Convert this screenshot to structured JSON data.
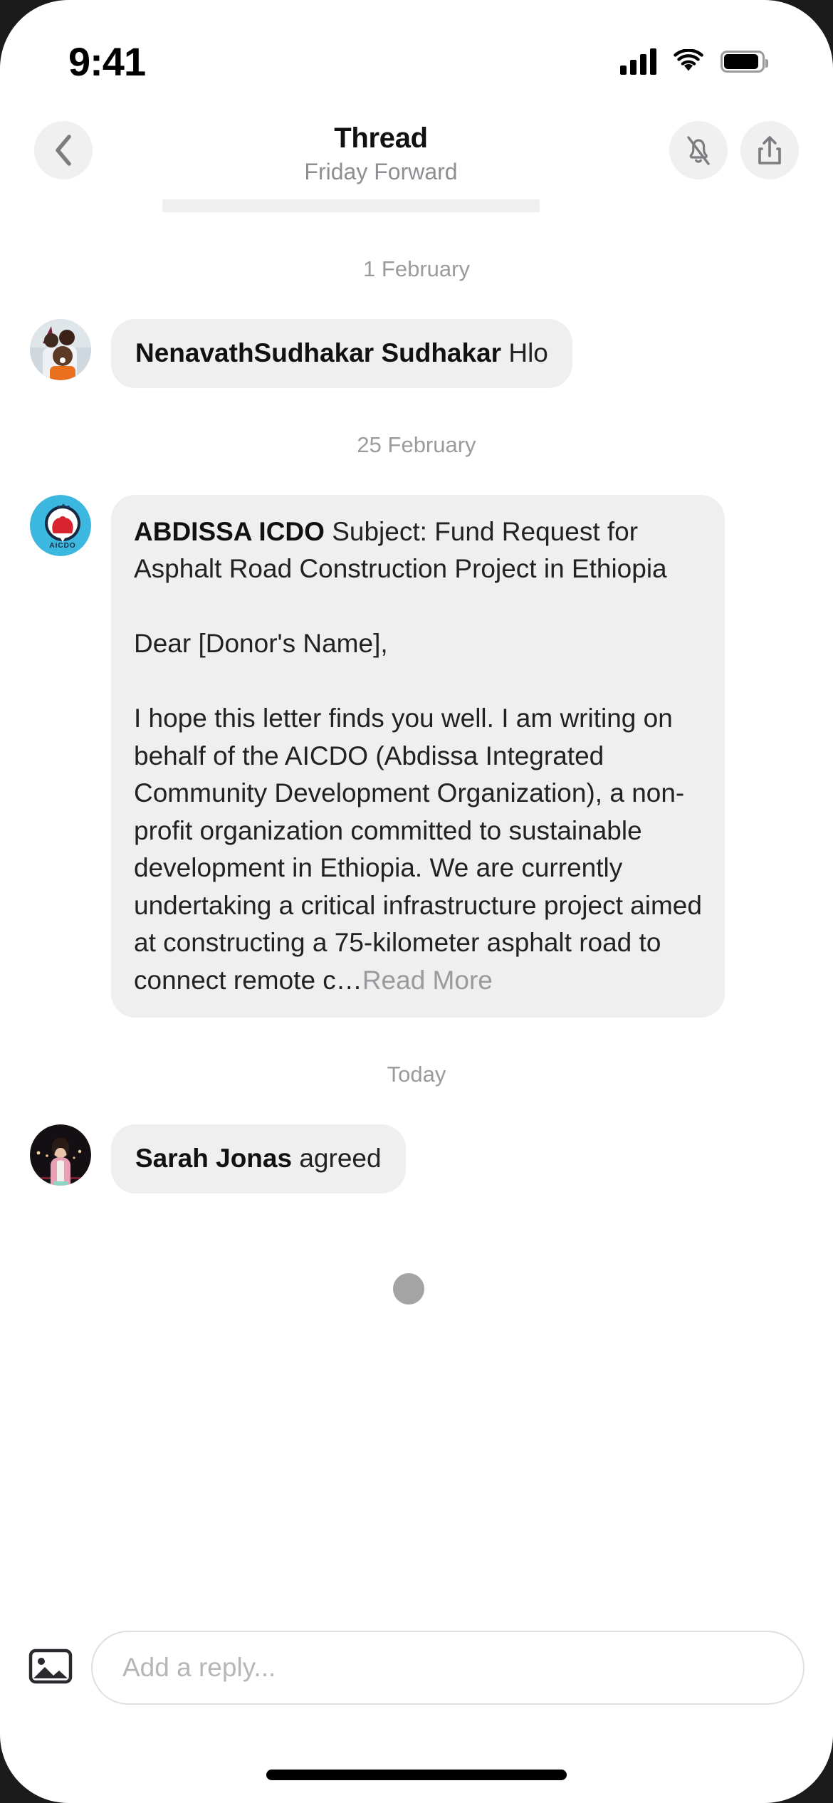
{
  "status_bar": {
    "time": "9:41",
    "signal_icon": "cellular-signal-icon",
    "wifi_icon": "wifi-icon",
    "battery_icon": "battery-icon"
  },
  "nav": {
    "back_icon": "chevron-left-icon",
    "title": "Thread",
    "subtitle": "Friday Forward",
    "mute_icon": "bell-slash-icon",
    "share_icon": "share-up-icon"
  },
  "thread": {
    "groups": [
      {
        "date": "1 February",
        "messages": [
          {
            "sender": "NenavathSudhakar Sudhakar",
            "text": "Hlo",
            "avatar": "group-photo-avatar",
            "truncated": false
          }
        ]
      },
      {
        "date": "25 February",
        "messages": [
          {
            "sender": "ABDISSA ICDO",
            "text": "Subject: Fund Request for Asphalt Road Construction Project in Ethiopia\n\nDear [Donor's Name],\n\nI hope this letter finds you well. I am writing on behalf of the AICDO (Abdissa Integrated Community Development Organization), a non-profit organization committed to sustainable development in Ethiopia. We are currently undertaking a critical infrastructure project aimed at constructing a 75-kilometer asphalt road to connect remote c…",
            "avatar": "aicdo-logo-avatar",
            "truncated": true,
            "read_more_label": "Read More"
          }
        ]
      },
      {
        "date": "Today",
        "messages": [
          {
            "sender": "Sarah Jonas",
            "text": "agreed",
            "avatar": "woman-photo-avatar",
            "truncated": false
          }
        ]
      }
    ]
  },
  "composer": {
    "attach_icon": "image-icon",
    "placeholder": "Add a reply..."
  },
  "colors": {
    "bubble": "#efeff0",
    "accent_logo": "#3cb8e0",
    "muted_text": "#9b9b9f"
  }
}
